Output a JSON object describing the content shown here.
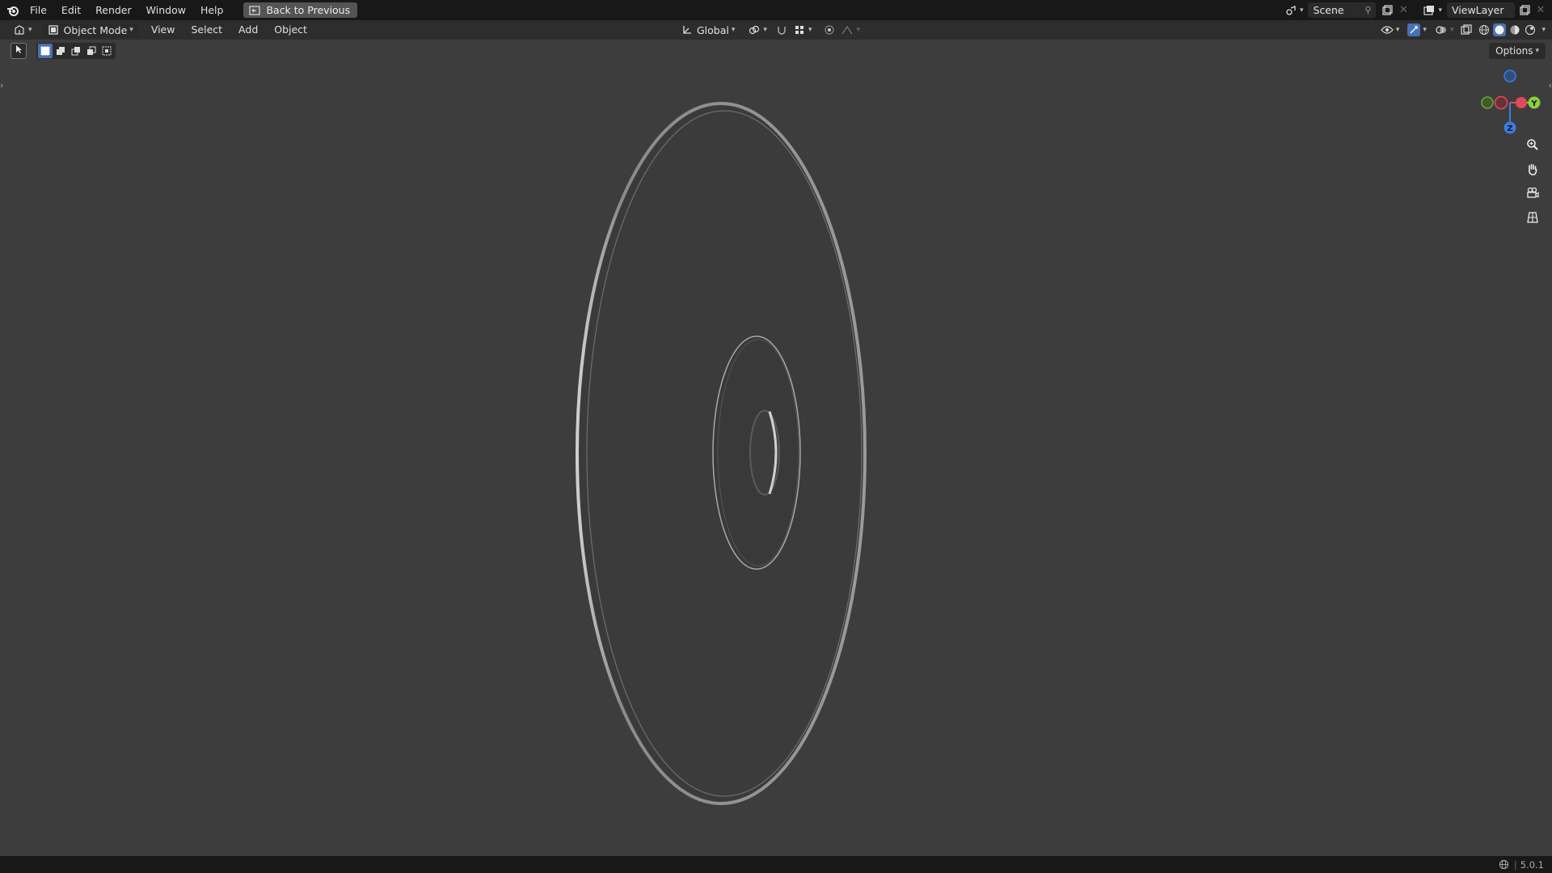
{
  "topbar": {
    "menus": [
      "File",
      "Edit",
      "Render",
      "Window",
      "Help"
    ],
    "back_button": "Back to Previous",
    "scene_name": "Scene",
    "view_layer_name": "ViewLayer"
  },
  "header": {
    "mode": "Object Mode",
    "menus": [
      "View",
      "Select",
      "Add",
      "Object"
    ],
    "orientation": "Global",
    "options": "Options"
  },
  "gizmo": {
    "y_label": "Y",
    "z_label": "Z"
  },
  "status": {
    "version": "5.0.1"
  },
  "colors": {
    "x_axis": "#e04a5a",
    "y_axis": "#8ad23a",
    "z_axis": "#3a7ce0",
    "accent": "#4772b3"
  }
}
